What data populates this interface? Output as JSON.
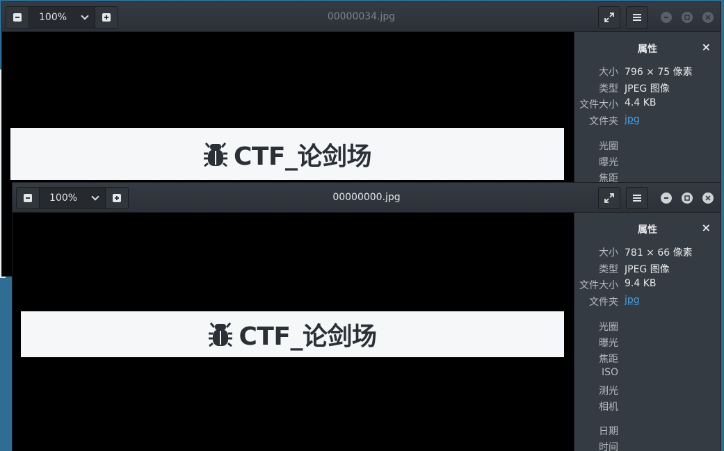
{
  "windows": [
    {
      "title": "00000034.jpg",
      "zoom": "100%",
      "image_text": "CTF_论剑场",
      "sidebar": {
        "title": "属性",
        "close": "×",
        "properties": [
          {
            "key": "大小",
            "value": "796 × 75 像素"
          },
          {
            "key": "类型",
            "value": "JPEG 图像"
          },
          {
            "key": "文件大小",
            "value": "4.4 KB"
          },
          {
            "key": "文件夹",
            "value": "jpg",
            "link": true
          }
        ],
        "exif": [
          {
            "key": "光圈"
          },
          {
            "key": "曝光"
          },
          {
            "key": "焦距"
          }
        ]
      }
    },
    {
      "title": "00000000.jpg",
      "zoom": "100%",
      "image_text": "CTF_论剑场",
      "sidebar": {
        "title": "属性",
        "close": "×",
        "properties": [
          {
            "key": "大小",
            "value": "781 × 66 像素"
          },
          {
            "key": "类型",
            "value": "JPEG 图像"
          },
          {
            "key": "文件大小",
            "value": "9.4 KB"
          },
          {
            "key": "文件夹",
            "value": "jpg",
            "link": true
          }
        ],
        "exif": [
          {
            "key": "光圈"
          },
          {
            "key": "曝光"
          },
          {
            "key": "焦距"
          },
          {
            "key": "ISO"
          },
          {
            "key": "测光"
          },
          {
            "key": "相机"
          }
        ],
        "datetime": [
          {
            "key": "日期"
          },
          {
            "key": "时间"
          }
        ]
      }
    }
  ],
  "colors": {
    "headerbar": "#2f343b",
    "sidebar": "#353b43",
    "link": "#4a9fe6",
    "desktop": "#2f6d95"
  }
}
